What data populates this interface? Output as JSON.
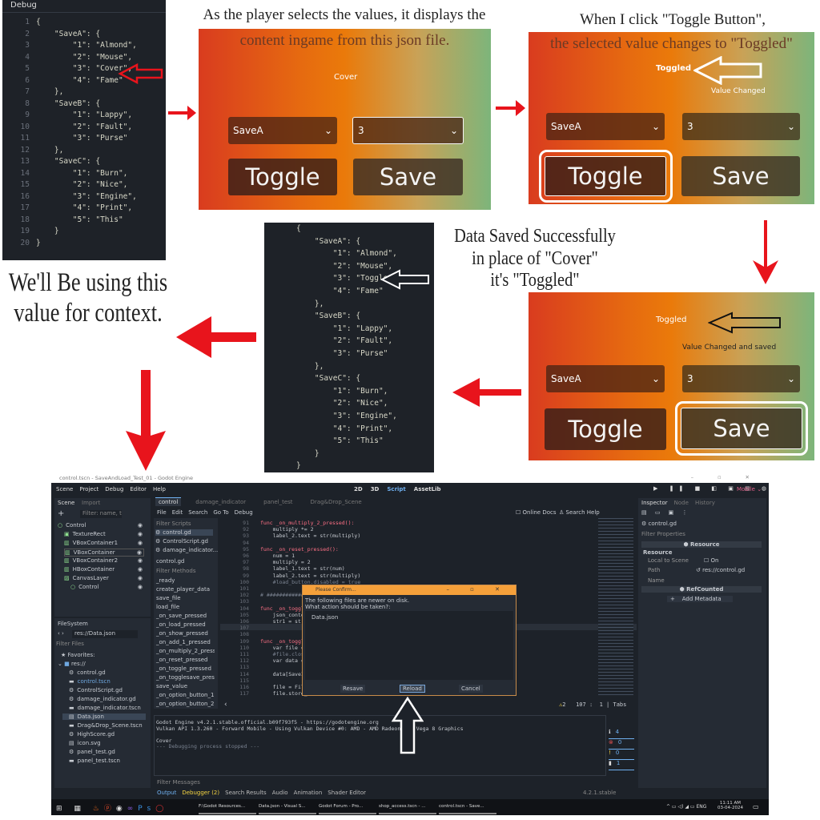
{
  "panel1": {
    "header": "Debug",
    "lines": [
      "{",
      "    \"SaveA\": {",
      "        \"1\": \"Almond\",",
      "        \"2\": \"Mouse\",",
      "        \"3\": \"Cover\",",
      "        \"4\": \"Fame\"",
      "    },",
      "    \"SaveB\": {",
      "        \"1\": \"Lappy\",",
      "        \"2\": \"Fault\",",
      "        \"3\": \"Purse\"",
      "    },",
      "    \"SaveC\": {",
      "        \"1\": \"Burn\",",
      "        \"2\": \"Nice\",",
      "        \"3\": \"Engine\",",
      "        \"4\": \"Print\",",
      "        \"5\": \"This\"",
      "    }",
      "}"
    ]
  },
  "captions": {
    "step1_line1": "As the player selects the values, it displays the",
    "step1_line2": "content ingame from this json file.",
    "step2_line1": "When I click \"Toggle Button\",",
    "step2_line2": "the selected value changes to \"Toggled\"",
    "step3_line1": "Data Saved Successfully",
    "step3_line2": "in place of \"Cover\"",
    "step3_line3": "it's \"Toggled\"",
    "context_line1": "We'll Be using this",
    "context_line2": "value for context."
  },
  "game1": {
    "label": "Cover",
    "save_select": "SaveA",
    "key_select": "3",
    "toggle": "Toggle",
    "save": "Save"
  },
  "game2": {
    "label": "Toggled",
    "status": "Value Changed",
    "save_select": "SaveA",
    "key_select": "3",
    "toggle": "Toggle",
    "save": "Save"
  },
  "game3": {
    "label": "Toggled",
    "status": "Value Changed and saved",
    "save_select": "SaveA",
    "key_select": "3",
    "toggle": "Toggle",
    "save": "Save"
  },
  "panel4": {
    "lines": [
      "{",
      "    \"SaveA\": {",
      "        \"1\": \"Almond\",",
      "        \"2\": \"Mouse\",",
      "        \"3\": \"Toggled\",",
      "        \"4\": \"Fame\"",
      "    },",
      "    \"SaveB\": {",
      "        \"1\": \"Lappy\",",
      "        \"2\": \"Fault\",",
      "        \"3\": \"Purse\"",
      "    },",
      "    \"SaveC\": {",
      "        \"1\": \"Burn\",",
      "        \"2\": \"Nice\",",
      "        \"3\": \"Engine\",",
      "        \"4\": \"Print\",",
      "        \"5\": \"This\"",
      "    }",
      "}"
    ]
  },
  "colors": {
    "arrow_red": "#e8141c",
    "gradient_left": "#d93c1f",
    "gradient_mid": "#ea7a0a",
    "gradient_right": "#7db57b",
    "dialog_title": "#f5a03a",
    "godot_bg": "#1d2229"
  },
  "godot": {
    "title": "control.tscn - SaveAndLoad_Test_01 - Godot Engine",
    "menu": [
      "Scene",
      "Project",
      "Debug",
      "Editor",
      "Help"
    ],
    "workspaces": [
      "2D",
      "3D",
      "Script",
      "AssetLib"
    ],
    "renderer": "Mobile",
    "scene_tabs": [
      "Scene",
      "Import"
    ],
    "scene_filter": "Filter: name, t",
    "scene_tree": [
      "Control",
      "TextureRect",
      "VBoxContainer1",
      "VBoxContainer",
      "VBoxContainer2",
      "HBoxContainer",
      "CanvasLayer",
      "Control"
    ],
    "filesystem": {
      "title": "FileSystem",
      "path": "res://Data.json",
      "filter": "Filter Files",
      "favorites": "Favorites:",
      "root": "res://",
      "files": [
        "control.gd",
        "control.tscn",
        "ControlScript.gd",
        "damage_indicator.gd",
        "damage_indicator.tscn",
        "Data.json",
        "Drag&Drop_Scene.tscn",
        "HighScore.gd",
        "icon.svg",
        "panel_test.gd",
        "panel_test.tscn"
      ]
    },
    "editor_tabs": [
      "control",
      "damage_indicator",
      "panel_test",
      "Drag&Drop_Scene"
    ],
    "script_menu": [
      "File",
      "Edit",
      "Search",
      "Go To",
      "Debug"
    ],
    "online_docs": "Online Docs",
    "search_help": "Search Help",
    "filter_scripts": "Filter Scripts",
    "scripts": [
      "control.gd",
      "ControlScript.gd",
      "damage_indicator..."
    ],
    "current_script": "control.gd",
    "filter_methods": "Filter Methods",
    "methods": [
      "_ready",
      "create_player_data",
      "save_file",
      "load_file",
      "_on_save_pressed",
      "_on_load_pressed",
      "_on_show_pressed",
      "_on_add_1_pressed",
      "_on_multiply_2_press...",
      "_on_reset_pressed",
      "_on_toggle_pressed",
      "_on_togglesave_pres...",
      "save_value",
      "_on_option_button_1...",
      "_on_option_button_2..."
    ],
    "code": [
      {
        "n": "91",
        "t": "func _on_multiply_2_pressed():"
      },
      {
        "n": "92",
        "t": "    multiply *= 2"
      },
      {
        "n": "93",
        "t": "    label_2.text = str(multiply)"
      },
      {
        "n": "94",
        "t": ""
      },
      {
        "n": "95",
        "t": "func _on_reset_pressed():"
      },
      {
        "n": "96",
        "t": "    num = 1"
      },
      {
        "n": "97",
        "t": "    multiply = 2"
      },
      {
        "n": "98",
        "t": "    label_1.text = str(num)"
      },
      {
        "n": "99",
        "t": "    label_2.text = str(multiply)"
      },
      {
        "n": "100",
        "t": "    #load_button.disabled = true"
      },
      {
        "n": "101",
        "t": ""
      },
      {
        "n": "102",
        "t": "# ##############################################################"
      },
      {
        "n": "103",
        "t": ""
      },
      {
        "n": "104",
        "t": "func _on_toggle_"
      },
      {
        "n": "105",
        "t": "    json_content"
      },
      {
        "n": "106",
        "t": "    str1 = str(j"
      },
      {
        "n": "107",
        "t": ""
      },
      {
        "n": "108",
        "t": ""
      },
      {
        "n": "109",
        "t": "func _on_toggles"
      },
      {
        "n": "110",
        "t": "    var file = J"
      },
      {
        "n": "111",
        "t": "    #file.close("
      },
      {
        "n": "112",
        "t": "    var data = f"
      },
      {
        "n": "113",
        "t": ""
      },
      {
        "n": "114",
        "t": "    data[SaveID]"
      },
      {
        "n": "115",
        "t": ""
      },
      {
        "n": "116",
        "t": "    file = FileA"
      },
      {
        "n": "117",
        "t": "    file.store_s"
      }
    ],
    "status": {
      "warnings": "2",
      "line": "107",
      "col": "1",
      "indent": "Tabs"
    },
    "output": [
      "Godot Engine v4.2.1.stable.official.b09f793f5 - https://godotengine.org",
      "Vulkan API 1.3.260 - Forward Mobile - Using Vulkan Device #0: AMD - AMD Radeon(TM) Vega 8 Graphics",
      "",
      "Cover",
      "--- Debugging process stopped ---"
    ],
    "output_counts": {
      "messages": "4",
      "errors": "0",
      "warnings": "0",
      "editor": "1"
    },
    "filter_messages": "Filter Messages",
    "bottom_tabs": [
      "Output",
      "Debugger (2)",
      "Search Results",
      "Audio",
      "Animation",
      "Shader Editor"
    ],
    "version": "4.2.1.stable",
    "inspector": {
      "tabs": [
        "Inspector",
        "Node",
        "History"
      ],
      "resource_name": "control.gd",
      "filter": "Filter Properties",
      "section_resource": "Resource",
      "group_resource": "Resource",
      "local_to_scene": "Local to Scene",
      "local_value": "On",
      "path_label": "Path",
      "path_value": "res://control.gd",
      "name_label": "Name",
      "section_refcounted": "RefCounted",
      "add_metadata": "Add Metadata"
    },
    "dialog": {
      "title": "Please Confirm...",
      "message1": "The following files are newer on disk.",
      "message2": "What action should be taken?:",
      "file": "Data.json",
      "resave": "Resave",
      "reload": "Reload",
      "cancel": "Cancel"
    },
    "taskbar": {
      "items": [
        "F:\\Godot Resources...",
        "Data.json - Visual S...",
        "Godot Forum - Pro...",
        "shop_access.tscn - ...",
        "control.tscn - Save..."
      ],
      "lang": "ENG",
      "time": "11:11 AM",
      "date": "03-04-2024"
    }
  }
}
